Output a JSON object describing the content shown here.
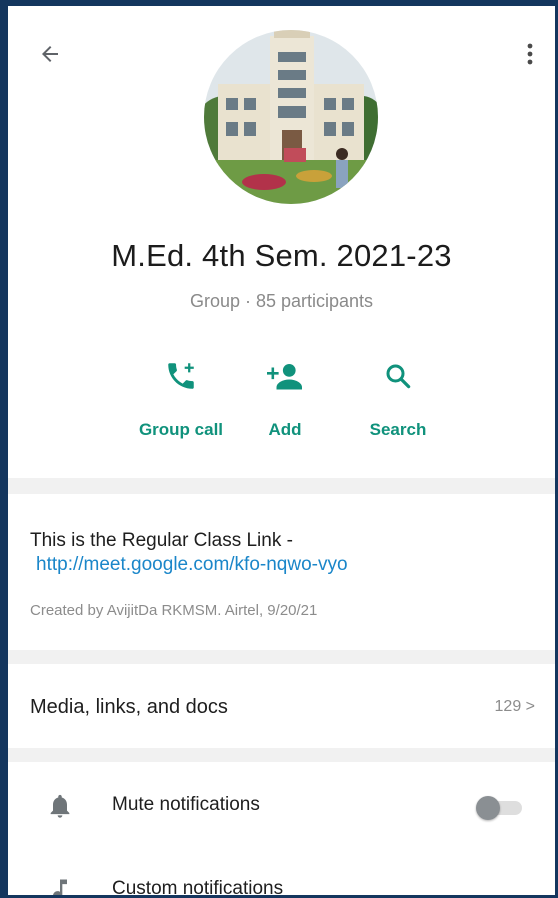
{
  "header": {
    "back_icon": "arrow-back-icon",
    "menu_icon": "more-vert-icon"
  },
  "group": {
    "name": "M.Ed. 4th Sem. 2021-23",
    "subtitle": "Group · 85 participants"
  },
  "actions": [
    {
      "label": "Group call",
      "icon": "add-call-icon"
    },
    {
      "label": "Add",
      "icon": "add-person-icon"
    },
    {
      "label": "Search",
      "icon": "search-icon"
    }
  ],
  "description": {
    "text": "This is the Regular Class Link -",
    "link": "http://meet.google.com/kfo-nqwo-vyo",
    "created": "Created by AvijitDa RKMSM. Airtel, 9/20/21"
  },
  "media": {
    "label": "Media, links, and docs",
    "count": "129 >"
  },
  "settings": [
    {
      "label": "Mute notifications",
      "icon": "bell-icon",
      "toggle_on": false
    },
    {
      "label": "Custom notifications",
      "icon": "music-note-icon"
    }
  ],
  "colors": {
    "accent": "#10927c",
    "link": "#1a86c9"
  }
}
